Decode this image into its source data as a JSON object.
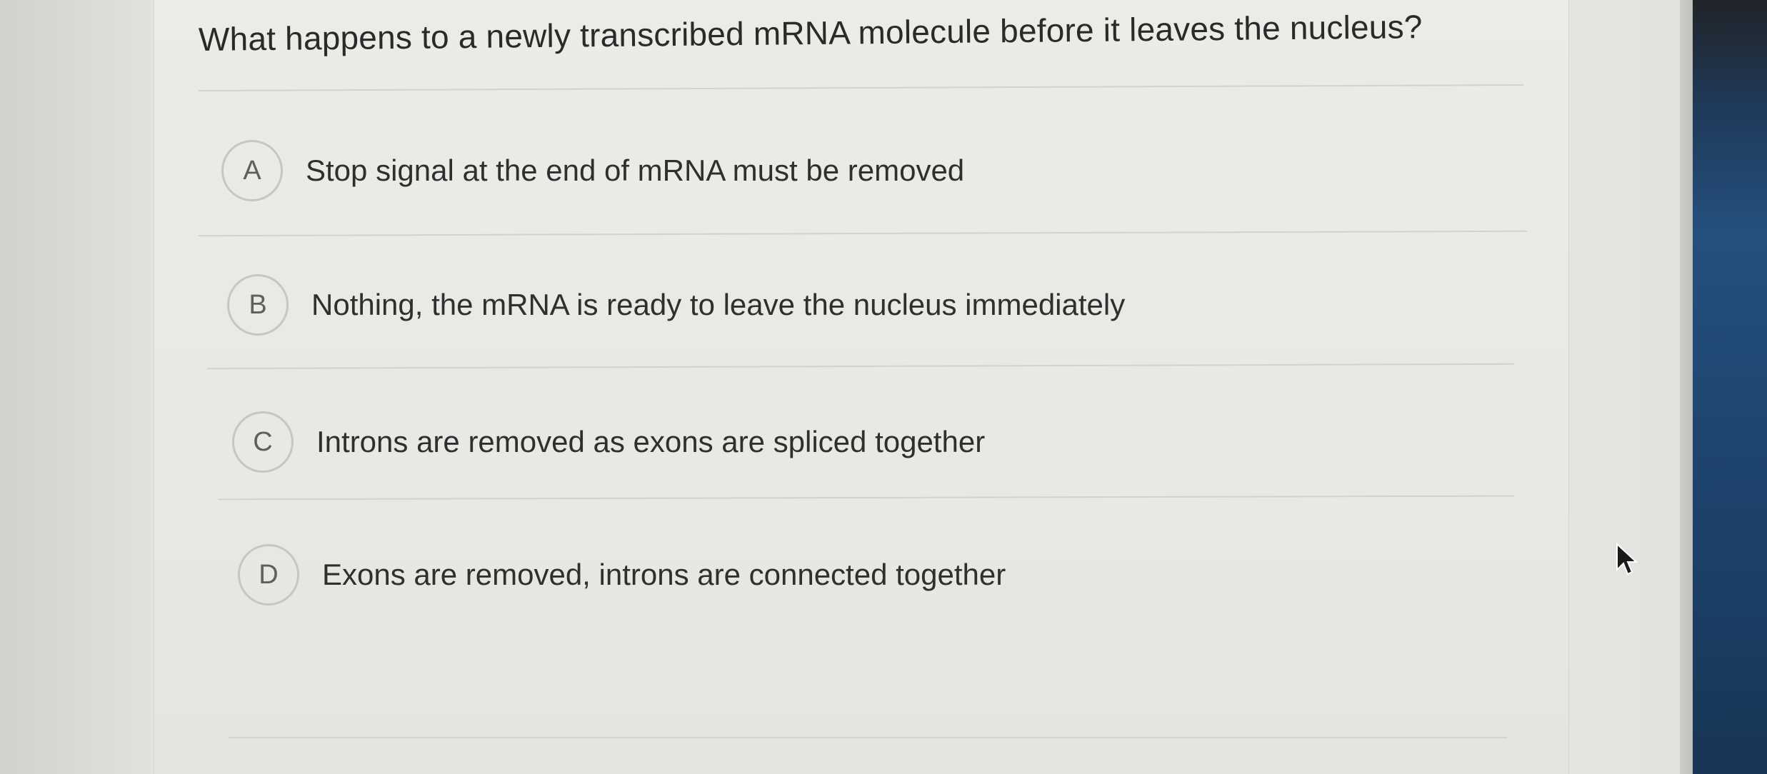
{
  "question": {
    "text": "What happens to a newly transcribed mRNA molecule before it leaves the nucleus?"
  },
  "options": [
    {
      "letter": "A",
      "text": "Stop signal at the end of mRNA must be removed"
    },
    {
      "letter": "B",
      "text": "Nothing, the mRNA is ready to leave the nucleus immediately"
    },
    {
      "letter": "C",
      "text": "Introns are removed as exons are spliced together"
    },
    {
      "letter": "D",
      "text": "Exons are removed, introns are connected together"
    }
  ],
  "icons": {
    "cursor": "mouse-pointer-icon"
  },
  "colors": {
    "background": "#ecebe7",
    "text": "#2f2f2f",
    "circle_border": "#c7c6c1",
    "letter": "#5f5f5f",
    "divider": "#d3d2cd"
  }
}
